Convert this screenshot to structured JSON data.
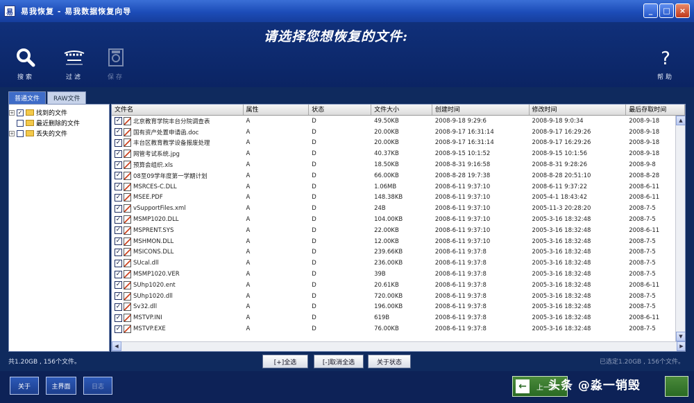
{
  "window": {
    "title": "易我恢复 - 易我数据恢复向导",
    "app_icon": "易",
    "minimize": "_",
    "maximize": "□",
    "close": "×"
  },
  "header": {
    "title": "请选择您想恢复的文件:"
  },
  "toolbar": {
    "search": "搜索",
    "filter": "过滤",
    "save": "保存",
    "help": "帮助"
  },
  "tabs": [
    "普通文件",
    "RAW文件"
  ],
  "tree": [
    {
      "label": "找到的文件",
      "checked": true,
      "expander": "+"
    },
    {
      "label": "最近删除的文件",
      "checked": false,
      "expander": ""
    },
    {
      "label": "丢失的文件",
      "checked": false,
      "expander": "+"
    }
  ],
  "columns": [
    "文件名",
    "属性",
    "状态",
    "文件大小",
    "创建时间",
    "修改时间",
    "最后存取时间"
  ],
  "rows": [
    {
      "name": "北京教育学院丰台分院调查表",
      "attr": "A",
      "state": "D",
      "size": "49.50KB",
      "ctime": "2008-9-18 9:29:6",
      "mtime": "2008-9-18 9:0:34",
      "atime": "2008-9-18"
    },
    {
      "name": "国有资产处置申请函.doc",
      "attr": "A",
      "state": "D",
      "size": "20.00KB",
      "ctime": "2008-9-17 16:31:14",
      "mtime": "2008-9-17 16:29:26",
      "atime": "2008-9-18"
    },
    {
      "name": "丰台区教育教学设备报废处理",
      "attr": "A",
      "state": "D",
      "size": "20.00KB",
      "ctime": "2008-9-17 16:31:14",
      "mtime": "2008-9-17 16:29:26",
      "atime": "2008-9-18"
    },
    {
      "name": "网管考试系统.jpg",
      "attr": "A",
      "state": "D",
      "size": "40.37KB",
      "ctime": "2008-9-15 10:1:52",
      "mtime": "2008-9-15 10:1:56",
      "atime": "2008-9-18"
    },
    {
      "name": "预算会组织.xls",
      "attr": "A",
      "state": "D",
      "size": "18.50KB",
      "ctime": "2008-8-31 9:16:58",
      "mtime": "2008-8-31 9:28:26",
      "atime": "2008-9-8"
    },
    {
      "name": "08至09学年度第一学期计划",
      "attr": "A",
      "state": "D",
      "size": "66.00KB",
      "ctime": "2008-8-28 19:7:38",
      "mtime": "2008-8-28 20:51:10",
      "atime": "2008-8-28"
    },
    {
      "name": "MSRCES-C.DLL",
      "attr": "A",
      "state": "D",
      "size": "1.06MB",
      "ctime": "2008-6-11 9:37:10",
      "mtime": "2008-6-11 9:37:22",
      "atime": "2008-6-11"
    },
    {
      "name": "MSEE.PDF",
      "attr": "A",
      "state": "D",
      "size": "148.38KB",
      "ctime": "2008-6-11 9:37:10",
      "mtime": "2005-4-1 18:43:42",
      "atime": "2008-6-11"
    },
    {
      "name": "vSupportFiles.xml",
      "attr": "A",
      "state": "D",
      "size": "24B",
      "ctime": "2008-6-11 9:37:10",
      "mtime": "2005-11-3 20:28:20",
      "atime": "2008-7-5"
    },
    {
      "name": "MSMP1020.DLL",
      "attr": "A",
      "state": "D",
      "size": "104.00KB",
      "ctime": "2008-6-11 9:37:10",
      "mtime": "2005-3-16 18:32:48",
      "atime": "2008-7-5"
    },
    {
      "name": "MSPRENT.SYS",
      "attr": "A",
      "state": "D",
      "size": "22.00KB",
      "ctime": "2008-6-11 9:37:10",
      "mtime": "2005-3-16 18:32:48",
      "atime": "2008-6-11"
    },
    {
      "name": "MSHMON.DLL",
      "attr": "A",
      "state": "D",
      "size": "12.00KB",
      "ctime": "2008-6-11 9:37:10",
      "mtime": "2005-3-16 18:32:48",
      "atime": "2008-7-5"
    },
    {
      "name": "MSICONS.DLL",
      "attr": "A",
      "state": "D",
      "size": "239.66KB",
      "ctime": "2008-6-11 9:37:8",
      "mtime": "2005-3-16 18:32:48",
      "atime": "2008-7-5"
    },
    {
      "name": "SUcal.dll",
      "attr": "A",
      "state": "D",
      "size": "236.00KB",
      "ctime": "2008-6-11 9:37:8",
      "mtime": "2005-3-16 18:32:48",
      "atime": "2008-7-5"
    },
    {
      "name": "MSMP1020.VER",
      "attr": "A",
      "state": "D",
      "size": "39B",
      "ctime": "2008-6-11 9:37:8",
      "mtime": "2005-3-16 18:32:48",
      "atime": "2008-7-5"
    },
    {
      "name": "SUhp1020.ent",
      "attr": "A",
      "state": "D",
      "size": "20.61KB",
      "ctime": "2008-6-11 9:37:8",
      "mtime": "2005-3-16 18:32:48",
      "atime": "2008-6-11"
    },
    {
      "name": "SUhp1020.dll",
      "attr": "A",
      "state": "D",
      "size": "720.00KB",
      "ctime": "2008-6-11 9:37:8",
      "mtime": "2005-3-16 18:32:48",
      "atime": "2008-7-5"
    },
    {
      "name": "Sv32.dll",
      "attr": "A",
      "state": "D",
      "size": "196.00KB",
      "ctime": "2008-6-11 9:37:8",
      "mtime": "2005-3-16 18:32:48",
      "atime": "2008-7-5"
    },
    {
      "name": "MSTVP.INI",
      "attr": "A",
      "state": "D",
      "size": "619B",
      "ctime": "2008-6-11 9:37:8",
      "mtime": "2005-3-16 18:32:48",
      "atime": "2008-6-11"
    },
    {
      "name": "MSTVP.EXE",
      "attr": "A",
      "state": "D",
      "size": "76.00KB",
      "ctime": "2008-6-11 9:37:8",
      "mtime": "2005-3-16 18:32:48",
      "atime": "2008-7-5"
    }
  ],
  "status": {
    "summary": "共1.20GB , 156个文件。",
    "right": "已选定1.20GB , 156个文件。"
  },
  "select_buttons": {
    "select_all": "[+]全选",
    "deselect_all": "[-]取消全选",
    "about_state": "关于状态"
  },
  "nav": {
    "about": "关于",
    "home": "主界面",
    "log": "日志",
    "back": "上一步",
    "back_arrow": "←"
  },
  "watermark": "头条 @淼一销毁",
  "colors": {
    "header_bg": "#0b2463",
    "accent": "#3e6cc8",
    "back_button": "#2a6a24"
  }
}
